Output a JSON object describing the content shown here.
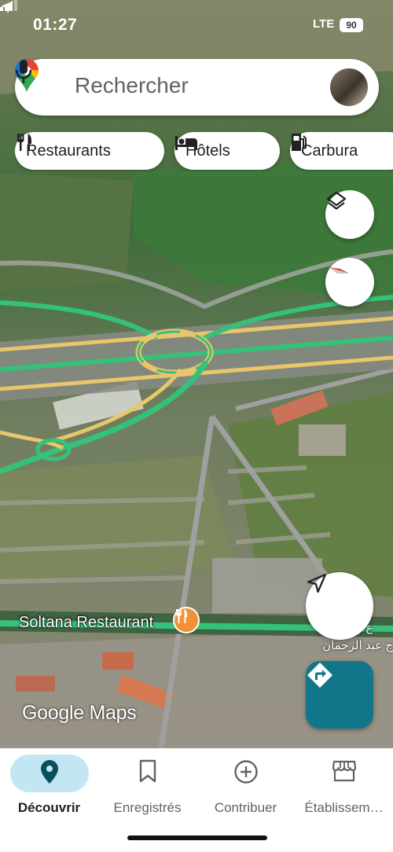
{
  "status_bar": {
    "time": "01:27",
    "network": "LTE",
    "battery": "90"
  },
  "search": {
    "placeholder": "Rechercher"
  },
  "chips": [
    {
      "label": "Restaurants",
      "icon": "fork-knife-icon"
    },
    {
      "label": "Hôtels",
      "icon": "bed-icon"
    },
    {
      "label": "Carbura",
      "icon": "gas-pump-icon"
    }
  ],
  "map": {
    "place_label": "Soltana Restaurant",
    "arabic_street_1": "ع الأ",
    "arabic_street_2": "ج عبد الرحمان",
    "watermark": "Google Maps"
  },
  "nav": [
    {
      "label": "Découvrir",
      "icon": "explore-pin-icon",
      "active": true
    },
    {
      "label": "Enregistrés",
      "icon": "bookmark-icon",
      "active": false
    },
    {
      "label": "Contribuer",
      "icon": "add-circle-icon",
      "active": false
    },
    {
      "label": "Établissem…",
      "icon": "storefront-icon",
      "active": false
    }
  ],
  "colors": {
    "accent": "#0a6d80",
    "nav_pill": "#c2e7f2",
    "directions_button": "#12768a",
    "route_green": "#34c27a",
    "route_yellow": "#e8c66b"
  }
}
